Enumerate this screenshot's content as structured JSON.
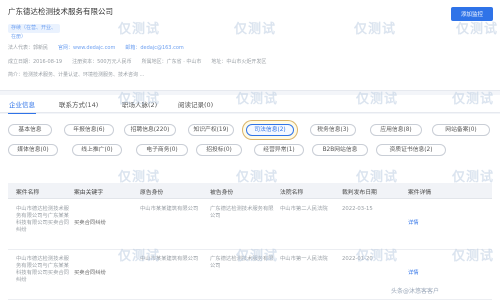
{
  "header": {
    "title": "广东德达检测技术服务有限公司",
    "monitor_button": "添加监控",
    "tag": "存续（在营、开业、在册）",
    "rows": [
      [
        {
          "t": "法人代表：郭新民"
        },
        {
          "t": "官网：www.dedajc.com",
          "link": true
        },
        {
          "t": "邮箱：dedajc@163.com",
          "link": true
        }
      ],
      [
        {
          "t": "成立日期：2016-08-19"
        },
        {
          "t": "注册资本：500万元人民币"
        },
        {
          "t": "所属地区：广东省 · 中山市"
        },
        {
          "t": "地址：中山市火炬开发区"
        }
      ],
      [
        {
          "t": "简介：检测技术服务、计量认证、环境检测服务、技术咨询 ..."
        }
      ]
    ]
  },
  "main_tabs": [
    "企业信息",
    "联系方式(14)",
    "职场人脉(2)",
    "阅读记录(0)"
  ],
  "category_pills": [
    [
      "基本信息",
      "年报信息(6)",
      "招聘信息(220)",
      "知识产权(19)",
      "司法信息(2)",
      "税务信息(3)",
      "应用信息(8)",
      "网站备案(0)"
    ],
    [
      "媒体信息(0)",
      "线上推广(0)",
      "电子商务(0)",
      "招投标(0)",
      "经营异常(1)",
      "B2B网站信息",
      "资质证书信息(2)"
    ]
  ],
  "table": {
    "columns": [
      "案件名称",
      "案由关键字",
      "原告身份",
      "被告身份",
      "法院名称",
      "裁判发布日期",
      "案件详情"
    ],
    "rows": [
      {
        "name": "中山市德达检测技术服务有限公司与广东某某科技有限公司买卖合同纠纷",
        "reason": "买卖合同纠纷",
        "plaintiff": "中山市某某建筑有限公司",
        "defendant": "广东德达检测技术服务有限公司",
        "court": "中山市第二人民法院",
        "date": "2022-03-15",
        "detail": "详情"
      },
      {
        "name": "中山市德达检测技术服务有限公司与广东某某科技有限公司买卖合同纠纷",
        "reason": "买卖合同纠纷",
        "plaintiff": "中山市某某建筑有限公司",
        "defendant": "广东德达检测技术服务有限公司",
        "court": "中山市第一人民法院",
        "date": "2022-01-20",
        "detail": "详情"
      }
    ]
  },
  "watermarks": [
    "仅测试",
    "仅测试",
    "仅测试",
    "仅测试",
    "仅测试",
    "仅测试",
    "仅测试",
    "仅测试",
    "仅测试",
    "仅测试",
    "仅测试",
    "仅测试",
    "仅测试",
    "仅测试",
    "仅测试",
    "仅测试"
  ],
  "bottom_watermark": "头条@沐悠客客户",
  "colors": {
    "accent": "#2f73e8",
    "highlight_ring": "#d9b36a"
  }
}
